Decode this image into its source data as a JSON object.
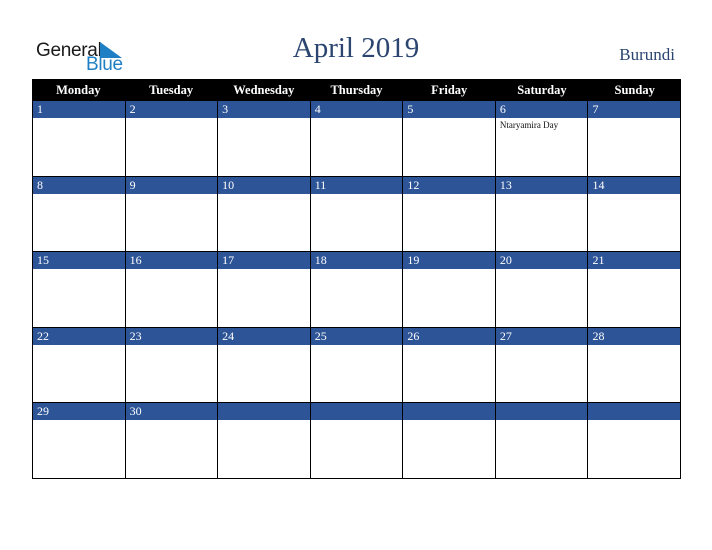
{
  "logo": {
    "line1": "General",
    "line2": "Blue",
    "icon": "triangle-flag-icon",
    "brand_color": "#1e7fc4"
  },
  "header": {
    "title": "April 2019",
    "country": "Burundi",
    "title_color": "#2b4570"
  },
  "colors": {
    "header_bg": "#000000",
    "day_bar": "#2d5496"
  },
  "weekdays": [
    "Monday",
    "Tuesday",
    "Wednesday",
    "Thursday",
    "Friday",
    "Saturday",
    "Sunday"
  ],
  "weeks": [
    [
      {
        "day": "1",
        "event": ""
      },
      {
        "day": "2",
        "event": ""
      },
      {
        "day": "3",
        "event": ""
      },
      {
        "day": "4",
        "event": ""
      },
      {
        "day": "5",
        "event": ""
      },
      {
        "day": "6",
        "event": "Ntaryamira Day"
      },
      {
        "day": "7",
        "event": ""
      }
    ],
    [
      {
        "day": "8",
        "event": ""
      },
      {
        "day": "9",
        "event": ""
      },
      {
        "day": "10",
        "event": ""
      },
      {
        "day": "11",
        "event": ""
      },
      {
        "day": "12",
        "event": ""
      },
      {
        "day": "13",
        "event": ""
      },
      {
        "day": "14",
        "event": ""
      }
    ],
    [
      {
        "day": "15",
        "event": ""
      },
      {
        "day": "16",
        "event": ""
      },
      {
        "day": "17",
        "event": ""
      },
      {
        "day": "18",
        "event": ""
      },
      {
        "day": "19",
        "event": ""
      },
      {
        "day": "20",
        "event": ""
      },
      {
        "day": "21",
        "event": ""
      }
    ],
    [
      {
        "day": "22",
        "event": ""
      },
      {
        "day": "23",
        "event": ""
      },
      {
        "day": "24",
        "event": ""
      },
      {
        "day": "25",
        "event": ""
      },
      {
        "day": "26",
        "event": ""
      },
      {
        "day": "27",
        "event": ""
      },
      {
        "day": "28",
        "event": ""
      }
    ],
    [
      {
        "day": "29",
        "event": ""
      },
      {
        "day": "30",
        "event": ""
      },
      {
        "day": "",
        "event": ""
      },
      {
        "day": "",
        "event": ""
      },
      {
        "day": "",
        "event": ""
      },
      {
        "day": "",
        "event": ""
      },
      {
        "day": "",
        "event": ""
      }
    ]
  ]
}
